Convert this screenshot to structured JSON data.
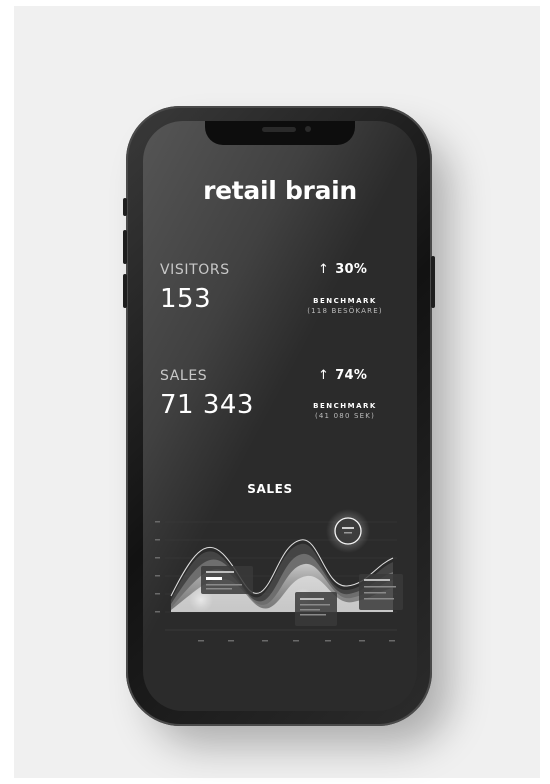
{
  "brand": {
    "name": "retail brain"
  },
  "metrics": [
    {
      "label": "VISITORS",
      "value": "153",
      "change": "30%",
      "benchmark_label": "BENCHMARK",
      "benchmark_value": "(118 BESÖKARE)"
    },
    {
      "label": "SALES",
      "value": "71 343",
      "change": "74%",
      "benchmark_label": "BENCHMARK",
      "benchmark_value": "(41 080 SEK)"
    }
  ],
  "chart": {
    "title": "SALES"
  },
  "icons": {
    "change_arrow": "arrow-up-icon",
    "highlight": "glow-marker-icon"
  },
  "colors": {
    "screen_bg": "#2b2b2b",
    "text_primary": "#ffffff",
    "text_secondary": "#c8c8c8"
  }
}
